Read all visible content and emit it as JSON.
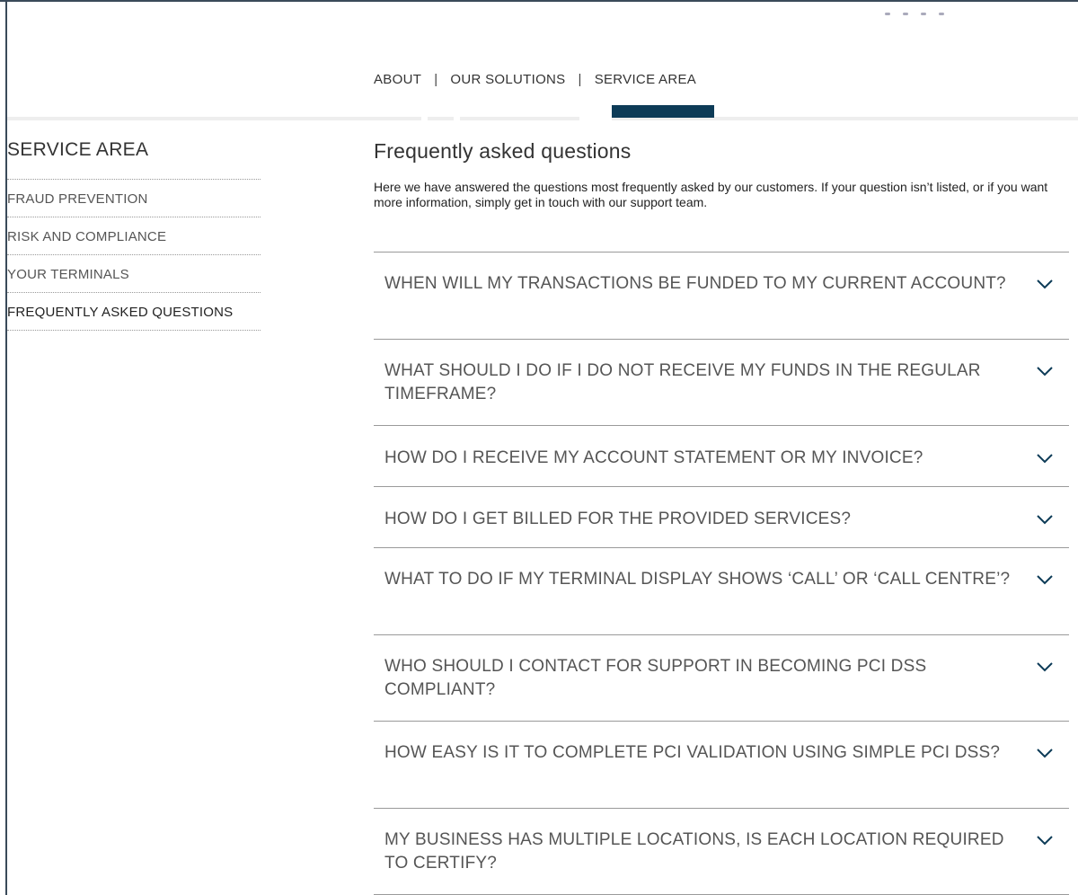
{
  "topnav": {
    "items": [
      {
        "label": "ABOUT"
      },
      {
        "label": "OUR SOLUTIONS"
      },
      {
        "label": "SERVICE AREA",
        "active": true
      }
    ],
    "separator": "|"
  },
  "sidebar": {
    "title": "SERVICE AREA",
    "items": [
      {
        "label": "FRAUD PREVENTION"
      },
      {
        "label": "RISK AND COMPLIANCE"
      },
      {
        "label": "YOUR TERMINALS"
      },
      {
        "label": "FREQUENTLY ASKED QUESTIONS",
        "active": true
      }
    ]
  },
  "main": {
    "title": "Frequently asked questions",
    "intro": "Here we have answered the questions most frequently asked by our customers. If your question isn’t listed, or if you want more information, simply get in touch with our support team.",
    "faq": [
      {
        "question": "WHEN WILL MY TRANSACTIONS BE FUNDED TO MY CURRENT ACCOUNT?"
      },
      {
        "question": "WHAT SHOULD I DO IF I DO NOT RECEIVE MY FUNDS IN THE REGULAR TIMEFRAME?"
      },
      {
        "question": "HOW DO I RECEIVE MY ACCOUNT STATEMENT OR MY INVOICE?"
      },
      {
        "question": "HOW DO I GET BILLED FOR THE PROVIDED SERVICES?"
      },
      {
        "question": "WHAT TO DO IF MY TERMINAL DISPLAY SHOWS ‘CALL’ OR ‘CALL CENTRE’?"
      },
      {
        "question": "WHO SHOULD I CONTACT FOR SUPPORT IN BECOMING PCI DSS COMPLIANT?"
      },
      {
        "question": "HOW EASY IS IT TO COMPLETE PCI VALIDATION USING SIMPLE PCI DSS?"
      },
      {
        "question": "MY BUSINESS HAS MULTIPLE LOCATIONS, IS EACH LOCATION REQUIRED TO CERTIFY?"
      }
    ],
    "expand_icon": "chevron-down-icon"
  },
  "colors": {
    "accent": "#0d3b57",
    "divider": "#9a9a9a",
    "text": "#555555"
  }
}
